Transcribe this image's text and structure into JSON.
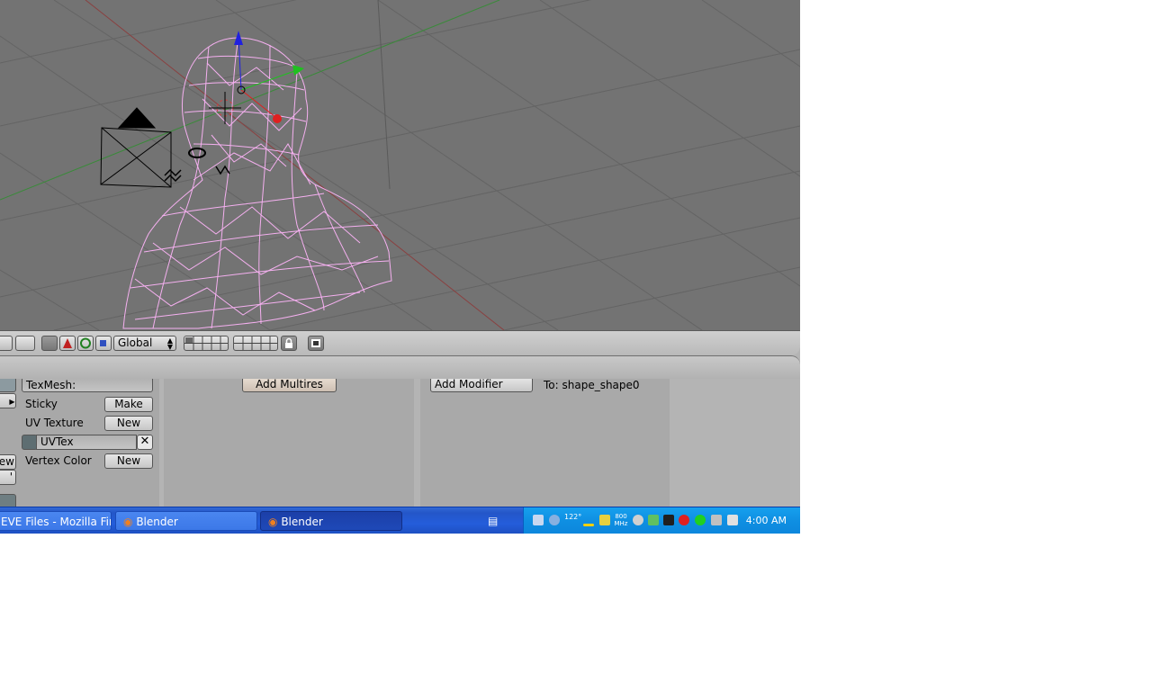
{
  "viewport": {
    "background": "#737373",
    "mesh_color": "#f5b0f0"
  },
  "view_header": {
    "orientation_value": "Global"
  },
  "mesh_panel": {
    "texmesh_label": "TexMesh:",
    "sticky_label": "Sticky",
    "sticky_button": "Make",
    "uvtexture_label": "UV Texture",
    "uvtexture_button": "New",
    "uvtex_layer": "UVTex",
    "vertexcolor_label": "Vertex Color",
    "vertexcolor_button": "New",
    "edge_left_text": "ew",
    "edge_left_text2": "'"
  },
  "multires_panel": {
    "add_multires_button": "Add Multires"
  },
  "modifiers_panel": {
    "add_modifier_button": "Add Modifier",
    "to_label": "To: shape_shape0"
  },
  "taskbar": {
    "tasks": [
      {
        "label": "EVE Files - Mozilla Fire..."
      },
      {
        "label": "Blender"
      },
      {
        "label": "Blender"
      }
    ],
    "clock": "4:00 AM",
    "temp_text": "122°",
    "cpu_text": "800 MHz"
  },
  "colors": {
    "taskbar": "#245ddb",
    "tray": "#0f8fe2",
    "accent_red": "#e02020"
  }
}
